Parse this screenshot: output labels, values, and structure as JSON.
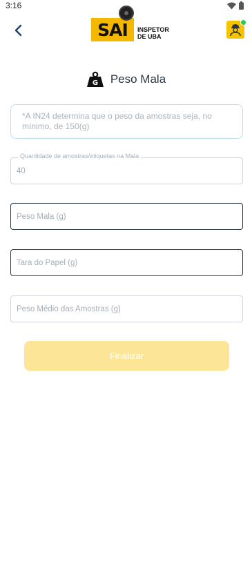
{
  "status_bar": {
    "time": "3:16"
  },
  "header": {
    "logo_text": "SAI",
    "logo_sub_line1": "INSPETOR",
    "logo_sub_line2": "DE UBA",
    "back_icon": "chevron-left-icon",
    "avatar_icon": "inspector-avatar-icon"
  },
  "page": {
    "title": "Peso Mala",
    "title_icon": "weight-icon"
  },
  "info_note": "*A IN24 determina que o peso da amostras seja, no mínimo, de 150(g)",
  "fields": {
    "quantidade": {
      "label": "Quantidade de amostras/etiquetas na Mala",
      "value": "40"
    },
    "peso_mala": {
      "placeholder": "Peso Mala (g)"
    },
    "tara_papel": {
      "placeholder": "Tara do Papel (g)"
    },
    "peso_medio": {
      "placeholder": "Peso Médio das Amostras (g)"
    }
  },
  "actions": {
    "finalize_label": "Finalizar"
  },
  "colors": {
    "brand_yellow": "#f5b800",
    "button_disabled": "#fde597",
    "text_dark": "#2d3a48",
    "online_green": "#22cc55"
  }
}
